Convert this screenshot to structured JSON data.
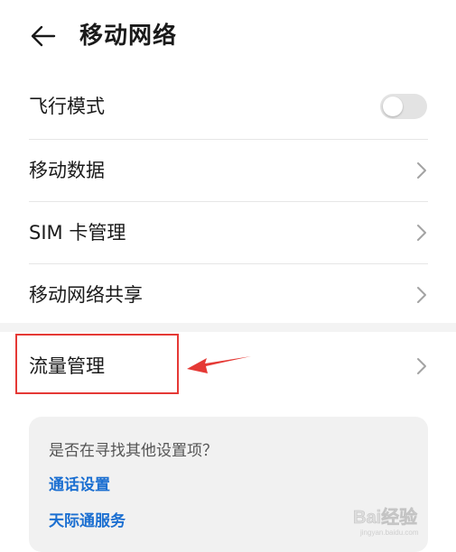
{
  "header": {
    "title": "移动网络",
    "back_icon": "arrow-left-icon"
  },
  "settings": {
    "airplane_mode": {
      "label": "飞行模式",
      "enabled": false
    },
    "mobile_data": {
      "label": "移动数据"
    },
    "sim_management": {
      "label": "SIM 卡管理"
    },
    "hotspot": {
      "label": "移动网络共享"
    },
    "data_usage": {
      "label": "流量管理"
    }
  },
  "suggestions": {
    "title": "是否在寻找其他设置项？",
    "links": [
      "通话设置",
      "天际通服务"
    ]
  },
  "annotation": {
    "highlight_color": "#e53935"
  },
  "colors": {
    "link": "#1b6fd1",
    "toggle_off": "#e3e3e3",
    "card_bg": "#f1f1f1"
  },
  "watermark": {
    "text": "Bai经验",
    "sub": "jingyan.baidu.com"
  }
}
